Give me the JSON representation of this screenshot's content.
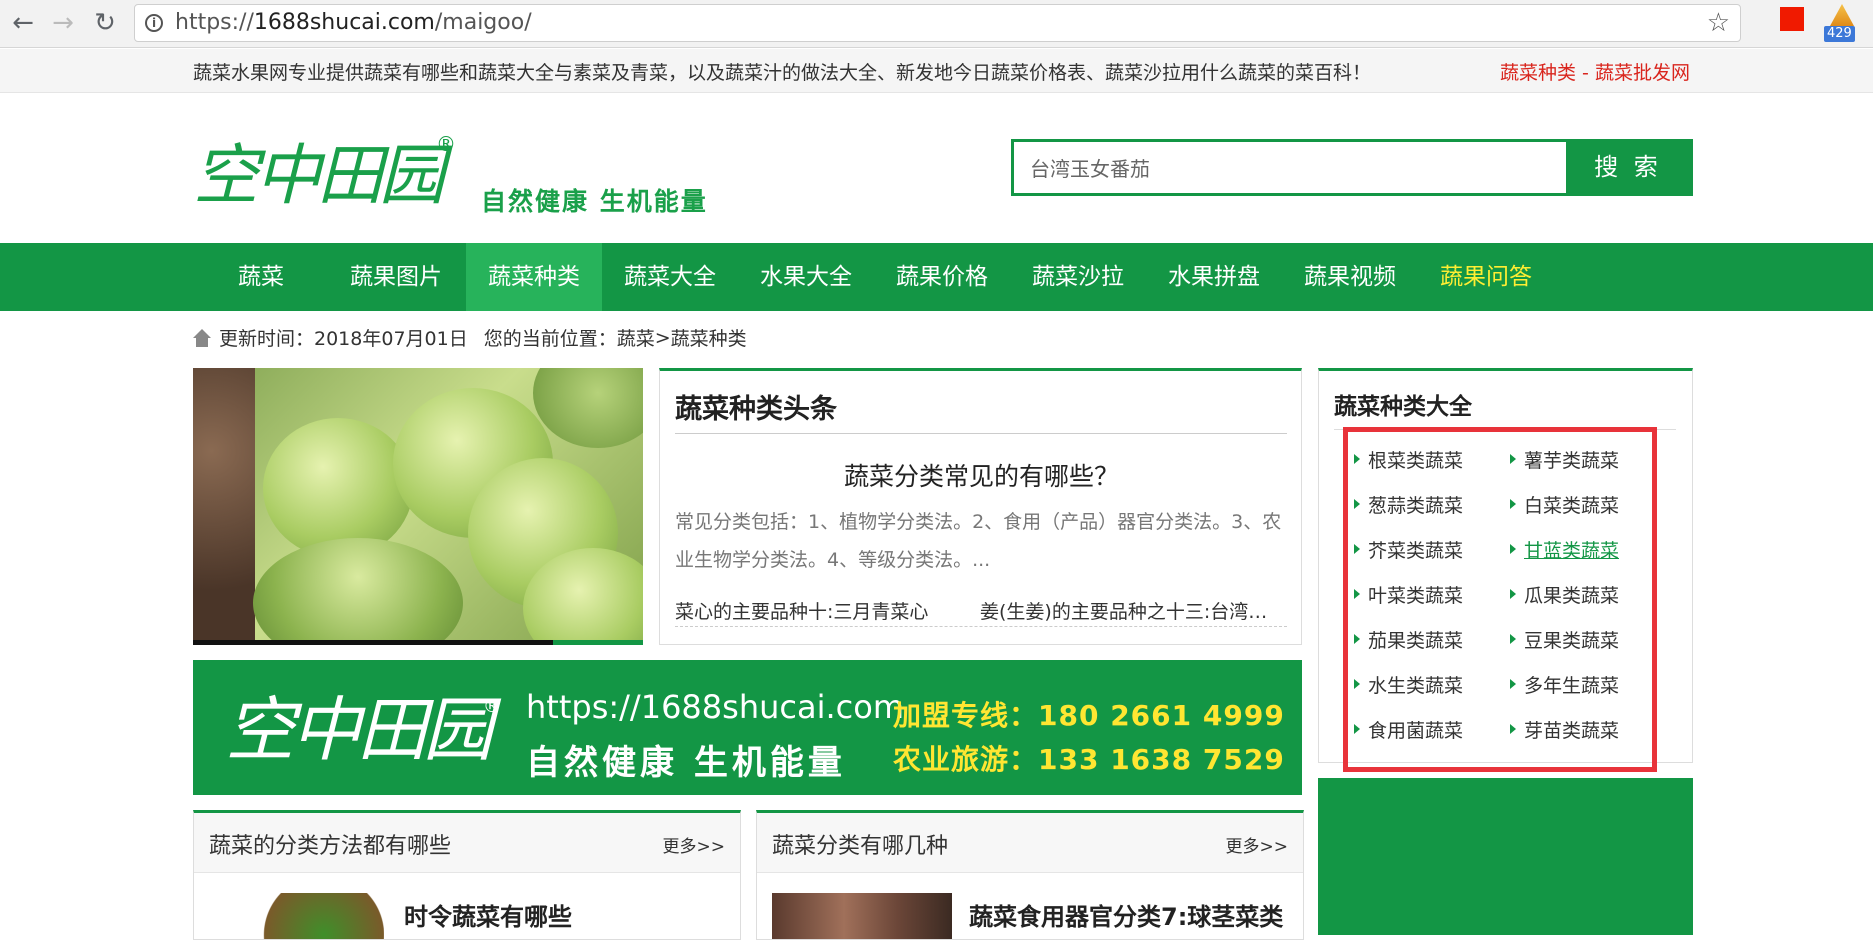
{
  "browser": {
    "url_prefix": "https://",
    "url_domain": "1688shucai.com",
    "url_path": "/maigoo/",
    "ext_badge": "429"
  },
  "topbar": {
    "notice": "蔬菜水果网专业提供蔬菜有哪些和蔬菜大全与素菜及青菜，以及蔬菜汁的做法大全、新发地今日蔬菜价格表、蔬菜沙拉用什么蔬菜的菜百科！",
    "link1": "蔬菜种类",
    "sep": " - ",
    "link2": "蔬菜批发网"
  },
  "logo": {
    "mark": "空中田园",
    "reg": "®",
    "slogan": "自然健康 生机能量"
  },
  "search": {
    "value": "台湾玉女番茄",
    "button": "搜 索"
  },
  "nav": [
    "蔬菜",
    "蔬果图片",
    "蔬菜种类",
    "蔬菜大全",
    "水果大全",
    "蔬果价格",
    "蔬菜沙拉",
    "水果拼盘",
    "蔬果视频",
    "蔬果问答"
  ],
  "crumb": {
    "updated": "更新时间：2018年07月01日",
    "position_label": "您的当前位置：",
    "link1": "蔬菜",
    "arrow": " > ",
    "link2": "蔬菜种类"
  },
  "headline": {
    "title": "蔬菜种类头条",
    "question": "蔬菜分类常见的有哪些？",
    "desc": "常见分类包括：1、植物学分类法。2、食用（产品）器官分类法。3、农业生物学分类法。4、等级分类法。...",
    "item1": "菜心的主要品种十:三月青菜心",
    "item2": "姜(生姜)的主要品种之十三:台湾…"
  },
  "sidebar": {
    "title": "蔬菜种类大全",
    "categories": [
      "根菜类蔬菜",
      "薯芋类蔬菜",
      "葱蒜类蔬菜",
      "白菜类蔬菜",
      "芥菜类蔬菜",
      "甘蓝类蔬菜",
      "叶菜类蔬菜",
      "瓜果类蔬菜",
      "茄果类蔬菜",
      "豆果类蔬菜",
      "水生类蔬菜",
      "多年生蔬菜",
      "食用菌蔬菜",
      "芽苗类蔬菜"
    ],
    "active_index": 5
  },
  "banner": {
    "mark": "空中田园",
    "reg": "®",
    "url": "https://1688shucai.com",
    "slogan": "自然健康 生机能量",
    "line1": "加盟专线：180 2661 4999",
    "line2": "农业旅游：133 1638 7529"
  },
  "panels": [
    {
      "title": "蔬菜的分类方法都有哪些",
      "more": "更多>>",
      "item": "时令蔬菜有哪些"
    },
    {
      "title": "蔬菜分类有哪几种",
      "more": "更多>>",
      "item": "蔬菜食用器官分类7:球茎菜类"
    }
  ]
}
